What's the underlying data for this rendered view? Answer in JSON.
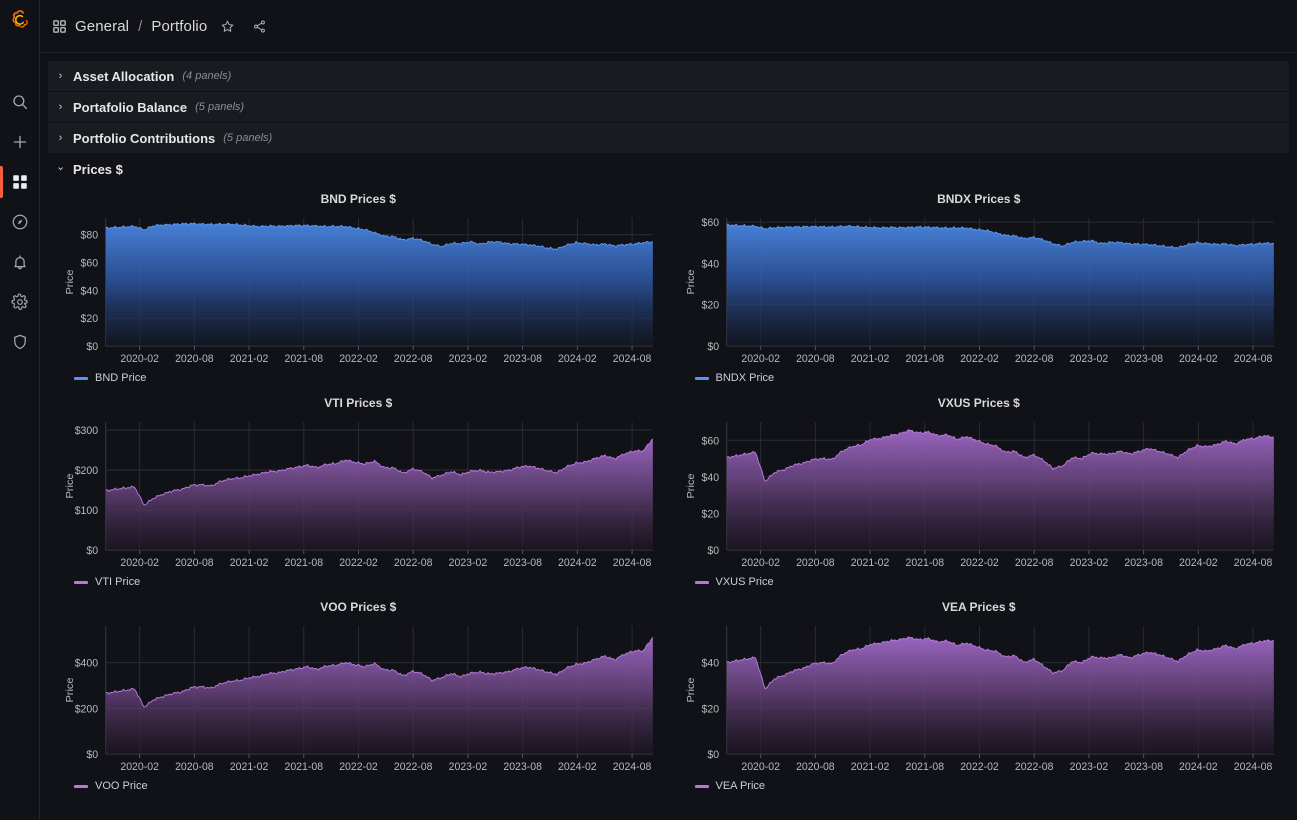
{
  "app": {
    "logo_icon": "grafana-logo-icon",
    "background": "#111217"
  },
  "sidebar": {
    "items": [
      {
        "name": "search",
        "icon": "search-icon",
        "active": false
      },
      {
        "name": "create",
        "icon": "plus-icon",
        "active": false
      },
      {
        "name": "dashboards",
        "icon": "dashboards-icon",
        "active": true
      },
      {
        "name": "explore",
        "icon": "compass-icon",
        "active": false
      },
      {
        "name": "alerting",
        "icon": "bell-icon",
        "active": false
      },
      {
        "name": "config",
        "icon": "gear-icon",
        "active": false
      },
      {
        "name": "admin",
        "icon": "shield-icon",
        "active": false
      }
    ],
    "active_indicator_color": "#f55f3e"
  },
  "topbar": {
    "dashboard_icon": "dashboard-grid-icon",
    "folder": "General",
    "separator": "/",
    "dashboard": "Portfolio",
    "star_icon": "star-icon",
    "share_icon": "share-icon"
  },
  "rows": [
    {
      "title": "Asset Allocation",
      "count": "(4 panels)",
      "expanded": false,
      "chevron": "›"
    },
    {
      "title": "Portafolio Balance",
      "count": "(5 panels)",
      "expanded": false,
      "chevron": "›"
    },
    {
      "title": "Portfolio Contributions",
      "count": "(5 panels)",
      "expanded": false,
      "chevron": "›"
    },
    {
      "title": "Prices $",
      "count": "",
      "expanded": true,
      "chevron": "⌄"
    }
  ],
  "panels": [
    {
      "title": "BND Prices $",
      "legend": "BND Price",
      "color": "#5794f2"
    },
    {
      "title": "BNDX Prices $",
      "legend": "BNDX Price",
      "color": "#5794f2"
    },
    {
      "title": "VTI Prices $",
      "legend": "VTI Price",
      "color": "#b877d9"
    },
    {
      "title": "VXUS Prices $",
      "legend": "VXUS Price",
      "color": "#b877d9"
    },
    {
      "title": "VOO Prices $",
      "legend": "VOO Price",
      "color": "#b877d9"
    },
    {
      "title": "VEA Prices $",
      "legend": "VEA Price",
      "color": "#b877d9"
    }
  ],
  "chart_data": [
    {
      "type": "area",
      "title": "BND Prices $",
      "series_name": "BND Price",
      "color": "#5794f2",
      "xlabel": "",
      "ylabel": "Price",
      "ylim": [
        0,
        92
      ],
      "yticks": [
        0,
        20,
        40,
        60,
        80
      ],
      "ytick_labels": [
        "$0",
        "$20",
        "$40",
        "$60",
        "$80"
      ],
      "xticks": [
        "2020-02",
        "2020-08",
        "2021-02",
        "2021-08",
        "2022-02",
        "2022-08",
        "2023-02",
        "2023-08",
        "2024-02",
        "2024-08"
      ],
      "grid": true,
      "legend_position": "bottom-left",
      "x": [
        "2019-11",
        "2019-12",
        "2020-01",
        "2020-02",
        "2020-03",
        "2020-04",
        "2020-05",
        "2020-06",
        "2020-07",
        "2020-08",
        "2020-09",
        "2020-10",
        "2020-11",
        "2020-12",
        "2021-01",
        "2021-02",
        "2021-03",
        "2021-04",
        "2021-05",
        "2021-06",
        "2021-07",
        "2021-08",
        "2021-09",
        "2021-10",
        "2021-11",
        "2021-12",
        "2022-01",
        "2022-02",
        "2022-03",
        "2022-04",
        "2022-05",
        "2022-06",
        "2022-07",
        "2022-08",
        "2022-09",
        "2022-10",
        "2022-11",
        "2022-12",
        "2023-01",
        "2023-02",
        "2023-03",
        "2023-04",
        "2023-05",
        "2023-06",
        "2023-07",
        "2023-08",
        "2023-09",
        "2023-10",
        "2023-11",
        "2023-12",
        "2024-01",
        "2024-02",
        "2024-03",
        "2024-04",
        "2024-05",
        "2024-06",
        "2024-07",
        "2024-08"
      ],
      "values": [
        84.8,
        85.2,
        85.6,
        86.0,
        83.5,
        86.5,
        87.0,
        87.3,
        87.8,
        87.9,
        87.6,
        87.4,
        87.5,
        87.6,
        87.0,
        86.4,
        85.8,
        86.2,
        86.0,
        86.3,
        86.6,
        86.5,
        86.2,
        85.8,
        86.0,
        85.8,
        84.6,
        83.6,
        81.4,
        79.0,
        78.5,
        76.2,
        77.4,
        76.0,
        73.0,
        71.5,
        73.8,
        73.6,
        74.9,
        73.1,
        74.8,
        74.7,
        73.4,
        73.2,
        72.8,
        71.9,
        70.4,
        69.6,
        72.4,
        74.2,
        73.6,
        72.6,
        73.3,
        71.9,
        72.8,
        73.2,
        74.3,
        74.8
      ]
    },
    {
      "type": "area",
      "title": "BNDX Prices $",
      "series_name": "BNDX Price",
      "color": "#5794f2",
      "xlabel": "",
      "ylabel": "Price",
      "ylim": [
        0,
        62
      ],
      "yticks": [
        0,
        20,
        40,
        60
      ],
      "ytick_labels": [
        "$0",
        "$20",
        "$40",
        "$60"
      ],
      "xticks": [
        "2020-02",
        "2020-08",
        "2021-02",
        "2021-08",
        "2022-02",
        "2022-08",
        "2023-02",
        "2023-08",
        "2024-02",
        "2024-08"
      ],
      "grid": true,
      "legend_position": "bottom-left",
      "x": [
        "2019-11",
        "2019-12",
        "2020-01",
        "2020-02",
        "2020-03",
        "2020-04",
        "2020-05",
        "2020-06",
        "2020-07",
        "2020-08",
        "2020-09",
        "2020-10",
        "2020-11",
        "2020-12",
        "2021-01",
        "2021-02",
        "2021-03",
        "2021-04",
        "2021-05",
        "2021-06",
        "2021-07",
        "2021-08",
        "2021-09",
        "2021-10",
        "2021-11",
        "2021-12",
        "2022-01",
        "2022-02",
        "2022-03",
        "2022-04",
        "2022-05",
        "2022-06",
        "2022-07",
        "2022-08",
        "2022-09",
        "2022-10",
        "2022-11",
        "2022-12",
        "2023-01",
        "2023-02",
        "2023-03",
        "2023-04",
        "2023-05",
        "2023-06",
        "2023-07",
        "2023-08",
        "2023-09",
        "2023-10",
        "2023-11",
        "2023-12",
        "2024-01",
        "2024-02",
        "2024-03",
        "2024-04",
        "2024-05",
        "2024-06",
        "2024-07",
        "2024-08"
      ],
      "values": [
        58.7,
        58.4,
        58.2,
        58.0,
        56.8,
        57.3,
        57.5,
        57.6,
        57.7,
        57.8,
        57.7,
        57.6,
        57.9,
        58.0,
        57.6,
        57.4,
        57.2,
        57.4,
        57.3,
        57.4,
        57.6,
        57.5,
        57.3,
        57.1,
        57.2,
        57.1,
        56.4,
        56.0,
        54.8,
        53.6,
        53.3,
        52.0,
        52.6,
        51.4,
        49.5,
        48.4,
        50.2,
        50.6,
        51.0,
        49.6,
        50.2,
        50.1,
        49.4,
        49.3,
        49.1,
        48.6,
        48.0,
        47.6,
        49.0,
        50.0,
        49.6,
        49.2,
        49.4,
        48.6,
        49.1,
        49.3,
        49.8,
        49.6
      ]
    },
    {
      "type": "area",
      "title": "VTI Prices $",
      "series_name": "VTI Price",
      "color": "#b877d9",
      "xlabel": "",
      "ylabel": "Price",
      "ylim": [
        0,
        320
      ],
      "yticks": [
        0,
        100,
        200,
        300
      ],
      "ytick_labels": [
        "$0",
        "$100",
        "$200",
        "$300"
      ],
      "xticks": [
        "2020-02",
        "2020-08",
        "2021-02",
        "2021-08",
        "2022-02",
        "2022-08",
        "2023-02",
        "2023-08",
        "2024-02",
        "2024-08"
      ],
      "grid": true,
      "legend_position": "bottom-left",
      "x": [
        "2019-11",
        "2019-12",
        "2020-01",
        "2020-02",
        "2020-03",
        "2020-04",
        "2020-05",
        "2020-06",
        "2020-07",
        "2020-08",
        "2020-09",
        "2020-10",
        "2020-11",
        "2020-12",
        "2021-01",
        "2021-02",
        "2021-03",
        "2021-04",
        "2021-05",
        "2021-06",
        "2021-07",
        "2021-08",
        "2021-09",
        "2021-10",
        "2021-11",
        "2021-12",
        "2022-01",
        "2022-02",
        "2022-03",
        "2022-04",
        "2022-05",
        "2022-06",
        "2022-07",
        "2022-08",
        "2022-09",
        "2022-10",
        "2022-11",
        "2022-12",
        "2023-01",
        "2023-02",
        "2023-03",
        "2023-04",
        "2023-05",
        "2023-06",
        "2023-07",
        "2023-08",
        "2023-09",
        "2023-10",
        "2023-11",
        "2023-12",
        "2024-01",
        "2024-02",
        "2024-03",
        "2024-04",
        "2024-05",
        "2024-06",
        "2024-07",
        "2024-08"
      ],
      "values": [
        148,
        152,
        155,
        158,
        112,
        130,
        140,
        148,
        152,
        162,
        163,
        160,
        172,
        178,
        180,
        186,
        190,
        196,
        197,
        203,
        207,
        212,
        206,
        214,
        216,
        225,
        219,
        215,
        222,
        206,
        205,
        192,
        203,
        196,
        180,
        187,
        196,
        188,
        197,
        199,
        194,
        196,
        199,
        207,
        210,
        205,
        198,
        193,
        208,
        217,
        220,
        229,
        236,
        228,
        240,
        247,
        248,
        278
      ]
    },
    {
      "type": "area",
      "title": "VXUS Prices $",
      "series_name": "VXUS Price",
      "color": "#b877d9",
      "xlabel": "",
      "ylabel": "Price",
      "ylim": [
        0,
        70
      ],
      "yticks": [
        0,
        20,
        40,
        60
      ],
      "ytick_labels": [
        "$0",
        "$20",
        "$40",
        "$60"
      ],
      "xticks": [
        "2020-02",
        "2020-08",
        "2021-02",
        "2021-08",
        "2022-02",
        "2022-08",
        "2023-02",
        "2023-08",
        "2024-02",
        "2024-08"
      ],
      "grid": true,
      "legend_position": "bottom-left",
      "x": [
        "2019-11",
        "2019-12",
        "2020-01",
        "2020-02",
        "2020-03",
        "2020-04",
        "2020-05",
        "2020-06",
        "2020-07",
        "2020-08",
        "2020-09",
        "2020-10",
        "2020-11",
        "2020-12",
        "2021-01",
        "2021-02",
        "2021-03",
        "2021-04",
        "2021-05",
        "2021-06",
        "2021-07",
        "2021-08",
        "2021-09",
        "2021-10",
        "2021-11",
        "2021-12",
        "2022-01",
        "2022-02",
        "2022-03",
        "2022-04",
        "2022-05",
        "2022-06",
        "2022-07",
        "2022-08",
        "2022-09",
        "2022-10",
        "2022-11",
        "2022-12",
        "2023-01",
        "2023-02",
        "2023-03",
        "2023-04",
        "2023-05",
        "2023-06",
        "2023-07",
        "2023-08",
        "2023-09",
        "2023-10",
        "2023-11",
        "2023-12",
        "2024-01",
        "2024-02",
        "2024-03",
        "2024-04",
        "2024-05",
        "2024-06",
        "2024-07",
        "2024-08"
      ],
      "values": [
        50.5,
        51.5,
        52.5,
        53.5,
        37.5,
        42.5,
        44.0,
        46.5,
        47.5,
        49.5,
        50.0,
        49.5,
        54.0,
        56.5,
        57.5,
        60.5,
        61.0,
        62.5,
        63.5,
        65.5,
        64.0,
        64.5,
        62.5,
        63.0,
        60.5,
        62.0,
        60.0,
        58.0,
        57.0,
        53.5,
        54.0,
        50.5,
        52.0,
        49.0,
        44.5,
        46.0,
        50.5,
        50.0,
        53.0,
        52.5,
        52.5,
        54.0,
        52.5,
        54.0,
        55.5,
        54.0,
        52.5,
        50.5,
        54.5,
        57.0,
        56.5,
        57.5,
        59.5,
        58.0,
        60.5,
        61.0,
        62.5,
        61.5
      ]
    },
    {
      "type": "area",
      "title": "VOO Prices $",
      "series_name": "VOO Price",
      "color": "#b877d9",
      "xlabel": "",
      "ylabel": "Price",
      "ylim": [
        0,
        560
      ],
      "yticks": [
        0,
        200,
        400
      ],
      "ytick_labels": [
        "$0",
        "$200",
        "$400"
      ],
      "xticks": [
        "2020-02",
        "2020-08",
        "2021-02",
        "2021-08",
        "2022-02",
        "2022-08",
        "2023-02",
        "2023-08",
        "2024-02",
        "2024-08"
      ],
      "grid": true,
      "legend_position": "bottom-left",
      "x": [
        "2019-11",
        "2019-12",
        "2020-01",
        "2020-02",
        "2020-03",
        "2020-04",
        "2020-05",
        "2020-06",
        "2020-07",
        "2020-08",
        "2020-09",
        "2020-10",
        "2020-11",
        "2020-12",
        "2021-01",
        "2021-02",
        "2021-03",
        "2021-04",
        "2021-05",
        "2021-06",
        "2021-07",
        "2021-08",
        "2021-09",
        "2021-10",
        "2021-11",
        "2021-12",
        "2022-01",
        "2022-02",
        "2022-03",
        "2022-04",
        "2022-05",
        "2022-06",
        "2022-07",
        "2022-08",
        "2022-09",
        "2022-10",
        "2022-11",
        "2022-12",
        "2023-01",
        "2023-02",
        "2023-03",
        "2023-04",
        "2023-05",
        "2023-06",
        "2023-07",
        "2023-08",
        "2023-09",
        "2023-10",
        "2023-11",
        "2023-12",
        "2024-01",
        "2024-02",
        "2024-03",
        "2024-04",
        "2024-05",
        "2024-06",
        "2024-07",
        "2024-08"
      ],
      "values": [
        265,
        272,
        278,
        285,
        205,
        238,
        252,
        265,
        272,
        292,
        294,
        288,
        308,
        318,
        322,
        334,
        340,
        352,
        355,
        366,
        373,
        382,
        370,
        385,
        388,
        400,
        390,
        382,
        396,
        368,
        366,
        342,
        362,
        350,
        322,
        334,
        352,
        338,
        354,
        358,
        350,
        354,
        360,
        374,
        380,
        370,
        358,
        348,
        376,
        392,
        398,
        414,
        428,
        412,
        436,
        450,
        452,
        510
      ]
    },
    {
      "type": "area",
      "title": "VEA Prices $",
      "series_name": "VEA Price",
      "color": "#b877d9",
      "xlabel": "",
      "ylabel": "Price",
      "ylim": [
        0,
        56
      ],
      "yticks": [
        0,
        20,
        40
      ],
      "ytick_labels": [
        "$0",
        "$20",
        "$40"
      ],
      "xticks": [
        "2020-02",
        "2020-08",
        "2021-02",
        "2021-08",
        "2022-02",
        "2022-08",
        "2023-02",
        "2023-08",
        "2024-02",
        "2024-08"
      ],
      "grid": true,
      "legend_position": "bottom-left",
      "x": [
        "2019-11",
        "2019-12",
        "2020-01",
        "2020-02",
        "2020-03",
        "2020-04",
        "2020-05",
        "2020-06",
        "2020-07",
        "2020-08",
        "2020-09",
        "2020-10",
        "2020-11",
        "2020-12",
        "2021-01",
        "2021-02",
        "2021-03",
        "2021-04",
        "2021-05",
        "2021-06",
        "2021-07",
        "2021-08",
        "2021-09",
        "2021-10",
        "2021-11",
        "2021-12",
        "2022-01",
        "2022-02",
        "2022-03",
        "2022-04",
        "2022-05",
        "2022-06",
        "2022-07",
        "2022-08",
        "2022-09",
        "2022-10",
        "2022-11",
        "2022-12",
        "2023-01",
        "2023-02",
        "2023-03",
        "2023-04",
        "2023-05",
        "2023-06",
        "2023-07",
        "2023-08",
        "2023-09",
        "2023-10",
        "2023-11",
        "2023-12",
        "2024-01",
        "2024-02",
        "2024-03",
        "2024-04",
        "2024-05",
        "2024-06",
        "2024-07",
        "2024-08"
      ],
      "values": [
        40.0,
        40.8,
        41.5,
        42.2,
        28.5,
        33.0,
        34.5,
        36.5,
        37.5,
        39.5,
        40.0,
        39.5,
        43.5,
        45.5,
        46.0,
        48.0,
        48.5,
        49.5,
        50.0,
        51.0,
        50.0,
        50.5,
        49.0,
        49.5,
        47.5,
        48.5,
        47.0,
        45.5,
        45.0,
        42.5,
        43.0,
        40.0,
        41.5,
        38.5,
        35.5,
        36.5,
        40.5,
        40.0,
        42.5,
        42.0,
        42.0,
        43.5,
        42.0,
        43.5,
        44.5,
        43.5,
        42.0,
        40.5,
        43.5,
        45.5,
        45.0,
        46.0,
        47.5,
        46.0,
        48.0,
        48.5,
        49.5,
        49.5
      ]
    }
  ]
}
